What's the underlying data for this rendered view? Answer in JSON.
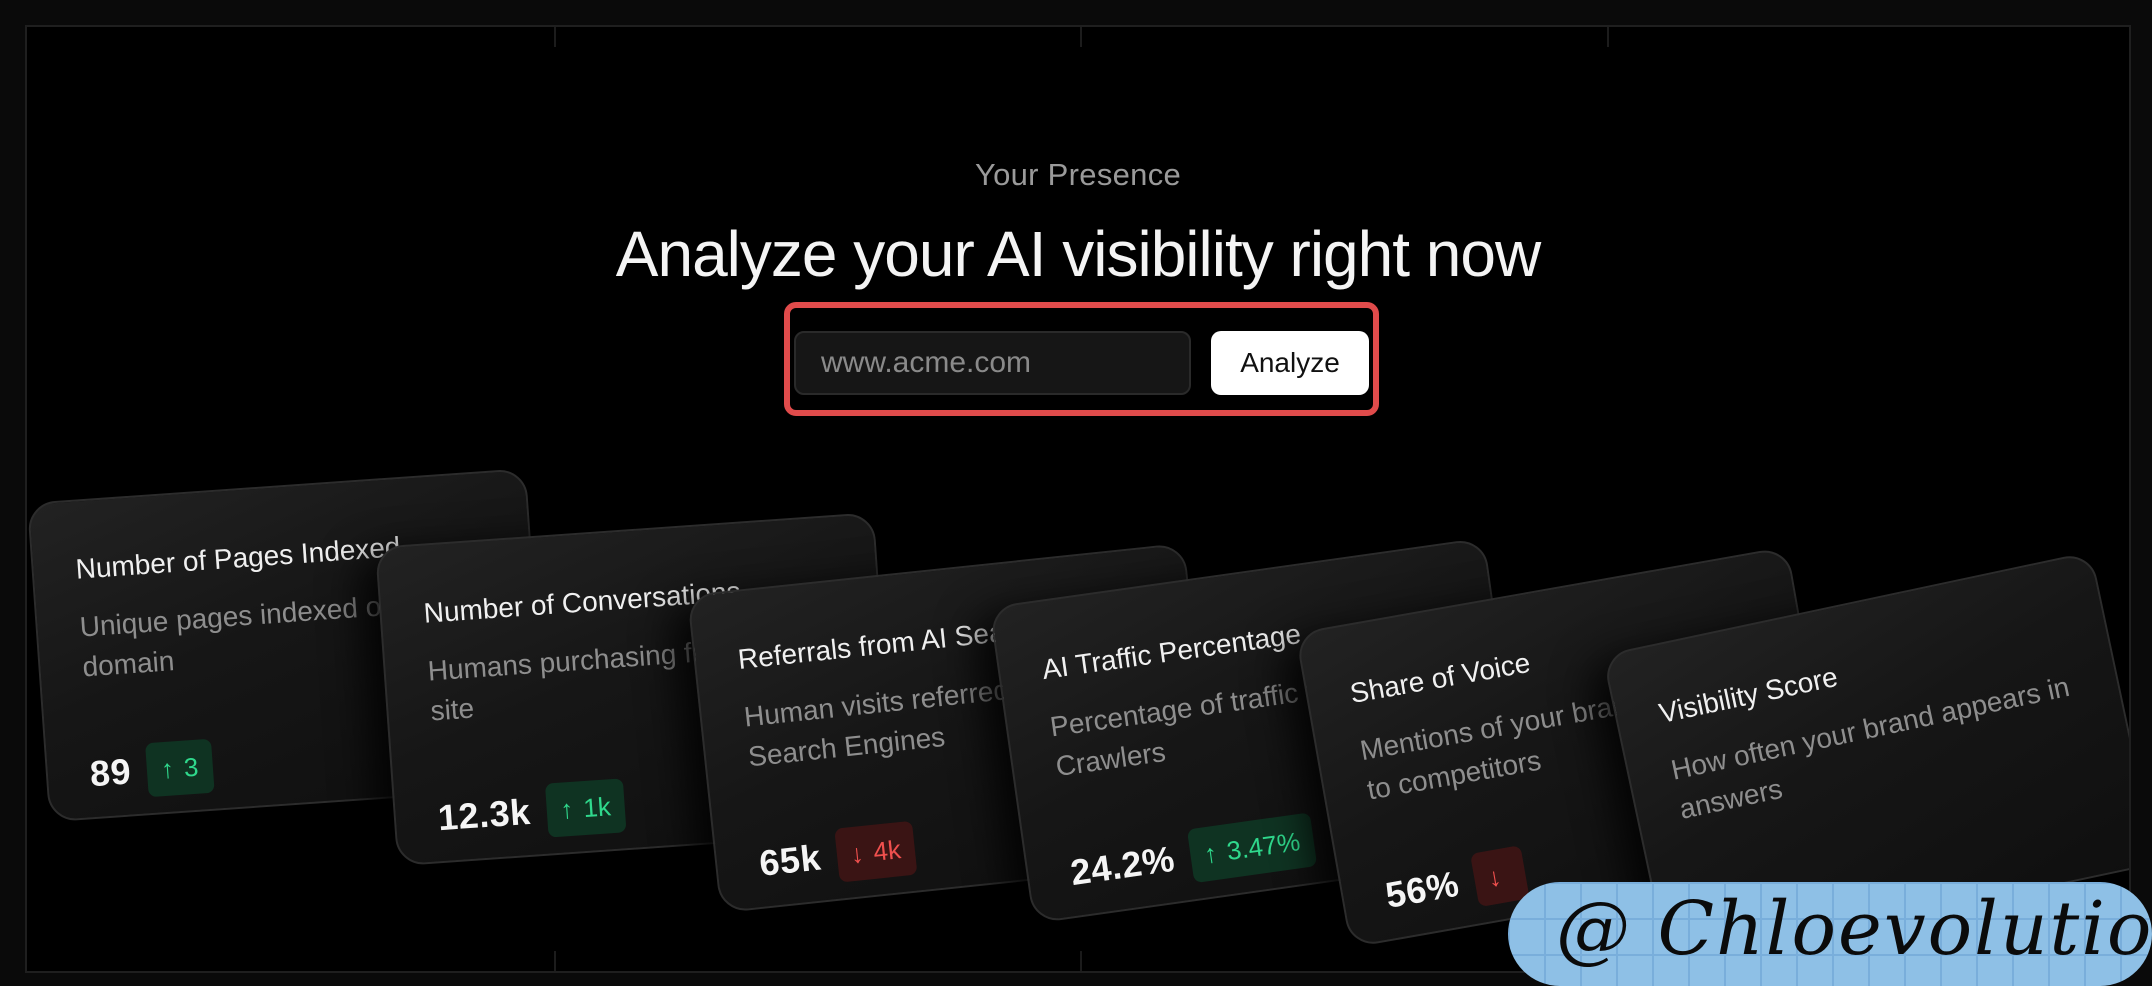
{
  "hero": {
    "eyebrow": "Your Presence",
    "title": "Analyze your AI visibility right now"
  },
  "form": {
    "placeholder": "www.acme.com",
    "button_label": "Analyze"
  },
  "cards": [
    {
      "title": "Number of Pages Indexed",
      "description": "Unique pages indexed on your domain",
      "value": "89",
      "change": "3",
      "direction": "up"
    },
    {
      "title": "Number of Conversations",
      "description": "Humans purchasing from your site",
      "value": "12.3k",
      "change": "1k",
      "direction": "up"
    },
    {
      "title": "Referrals from AI Search",
      "description": "Human visits referred by AI Search Engines",
      "value": "65k",
      "change": "4k",
      "direction": "down"
    },
    {
      "title": "AI Traffic Percentage",
      "description": "Percentage of traffic from AI Crawlers",
      "value": "24.2%",
      "change": "3.47%",
      "direction": "up"
    },
    {
      "title": "Share of Voice",
      "description": "Mentions of your brand compared to competitors",
      "value": "56%",
      "change": "",
      "direction": "down"
    },
    {
      "title": "Visibility Score",
      "description": "How often your brand appears in answers",
      "value": "",
      "change": "",
      "direction": "up"
    }
  ],
  "icons": {
    "up": "arrow-up-icon",
    "down": "arrow-down-icon"
  },
  "colors": {
    "highlight": "#e04b4b",
    "up": "#2fd88c",
    "down": "#f0504e"
  },
  "watermark": {
    "text": "@ Chloevolution"
  }
}
